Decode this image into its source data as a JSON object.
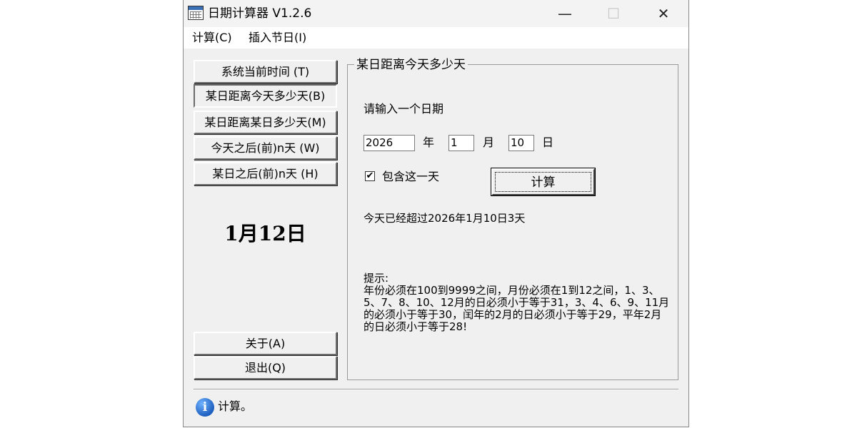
{
  "window": {
    "title": "日期计算器  V1.2.6",
    "controls": {
      "minimize": "—",
      "maximize": "☐",
      "close": "✕"
    }
  },
  "menu": [
    {
      "label": "计算(C)"
    },
    {
      "label": "插入节日(I)"
    }
  ],
  "sidebar": {
    "buttons": [
      {
        "label": "系统当前时间   (T)"
      },
      {
        "label": "某日距离今天多少天(B)"
      },
      {
        "label": "某日距离某日多少天(M)"
      },
      {
        "label": "今天之后(前)n天  (W)"
      },
      {
        "label": "某日之后(前)n天  (H)"
      }
    ],
    "today": "1月12日",
    "about": "关于(A)",
    "exit": "退出(Q)"
  },
  "panel": {
    "title": "某日距离今天多少天",
    "prompt": "请输入一个日期",
    "year_value": "2026",
    "year_unit": "年",
    "month_value": "1",
    "month_unit": "月",
    "day_value": "10",
    "day_unit": "日",
    "include_day": {
      "checked": true,
      "mark": "✔",
      "label": "包含这一天"
    },
    "calc_button": "计算",
    "result": "今天已经超过2026年1月10日3天",
    "hint_title": "提示:",
    "hint_body": "年份必须在100到9999之间，月份必须在1到12之间，1、3、5、7、8、10、12月的日必须小于等于31，3、4、6、9、11月的必须小于等于30，闰年的2月的日必须小于等于29，平年2月的日必须小于等于28!"
  },
  "status": {
    "icon": "info-icon",
    "text": "计算。"
  }
}
